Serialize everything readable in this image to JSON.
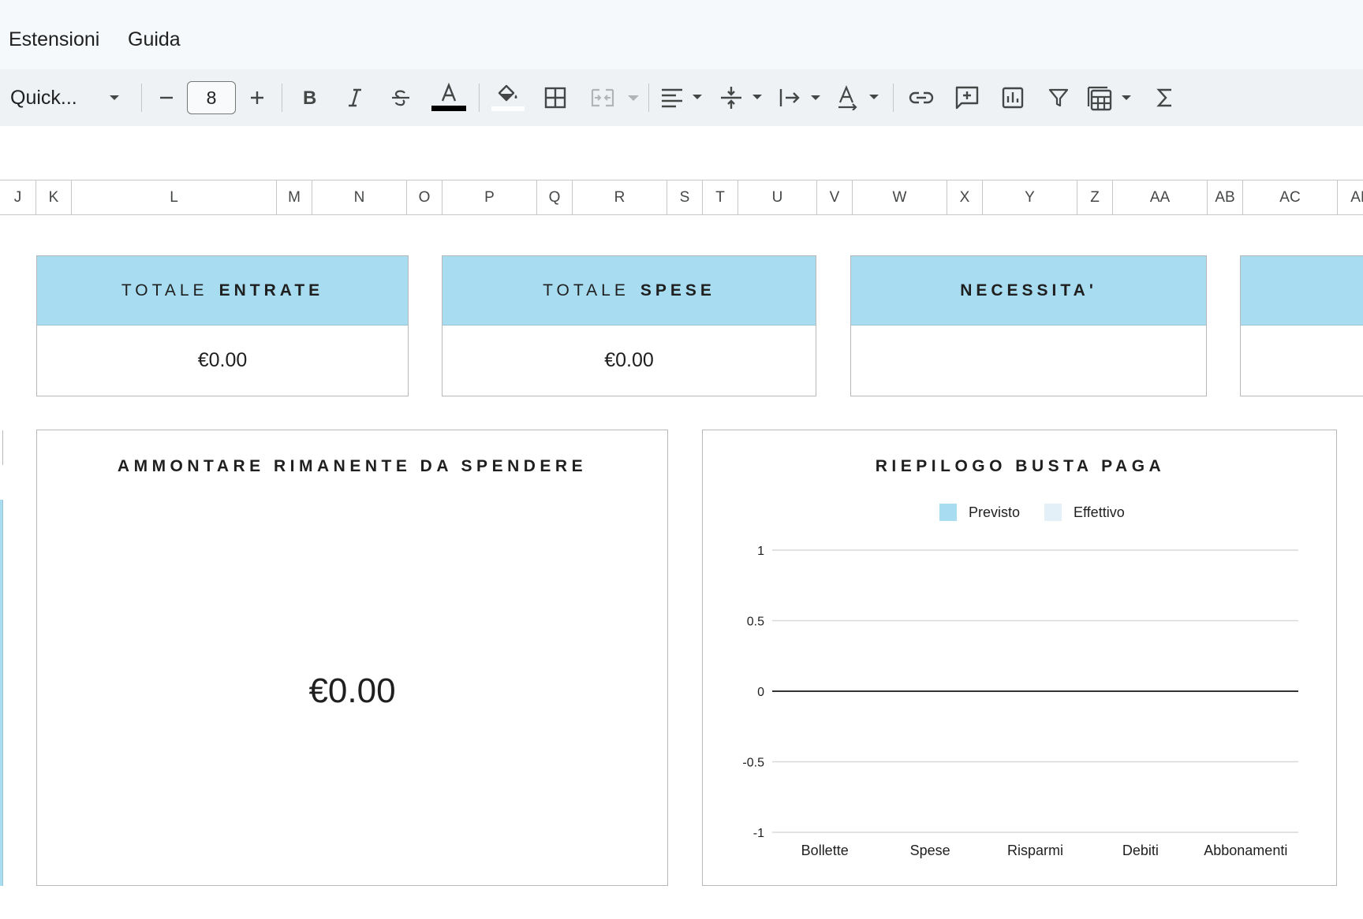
{
  "menu": [
    "Estensioni",
    "Guida"
  ],
  "toolbar": {
    "font_name": "Quick...",
    "font_size": "8",
    "text_color": "#000000",
    "fill_color": "#ffffff"
  },
  "columns": [
    "J",
    "K",
    "L",
    "M",
    "N",
    "O",
    "P",
    "Q",
    "R",
    "S",
    "T",
    "U",
    "V",
    "W",
    "X",
    "Y",
    "Z",
    "AA",
    "AB",
    "AC",
    "AD"
  ],
  "cards": [
    {
      "light": "TOTALE",
      "bold": "ENTRATE",
      "value": "€0.00"
    },
    {
      "light": "TOTALE",
      "bold": "SPESE",
      "value": "€0.00"
    },
    {
      "light": "",
      "bold": "NECESSITA'",
      "value": ""
    }
  ],
  "remaining_panel": {
    "title": "AMMONTARE RIMANENTE  DA SPENDERE",
    "value": "€0.00"
  },
  "chart_data": {
    "type": "bar",
    "title": "RIEPILOGO BUSTA PAGA",
    "categories": [
      "Bollette",
      "Spese",
      "Risparmi",
      "Debiti",
      "Abbonamenti"
    ],
    "series": [
      {
        "name": "Previsto",
        "color": "#a8dcf0",
        "values": [
          0,
          0,
          0,
          0,
          0
        ]
      },
      {
        "name": "Effettivo",
        "color": "#e3f0f7",
        "values": [
          0,
          0,
          0,
          0,
          0
        ]
      }
    ],
    "ylim": [
      -1,
      1
    ],
    "yticks": [
      "1",
      "0.5",
      "0",
      "-0.5",
      "-1"
    ],
    "legend": "top",
    "grid": true
  },
  "colors": {
    "card_header": "#a8dcf0",
    "menubar_bg": "#f6f9fb",
    "toolbar_bg": "#eef2f5"
  }
}
